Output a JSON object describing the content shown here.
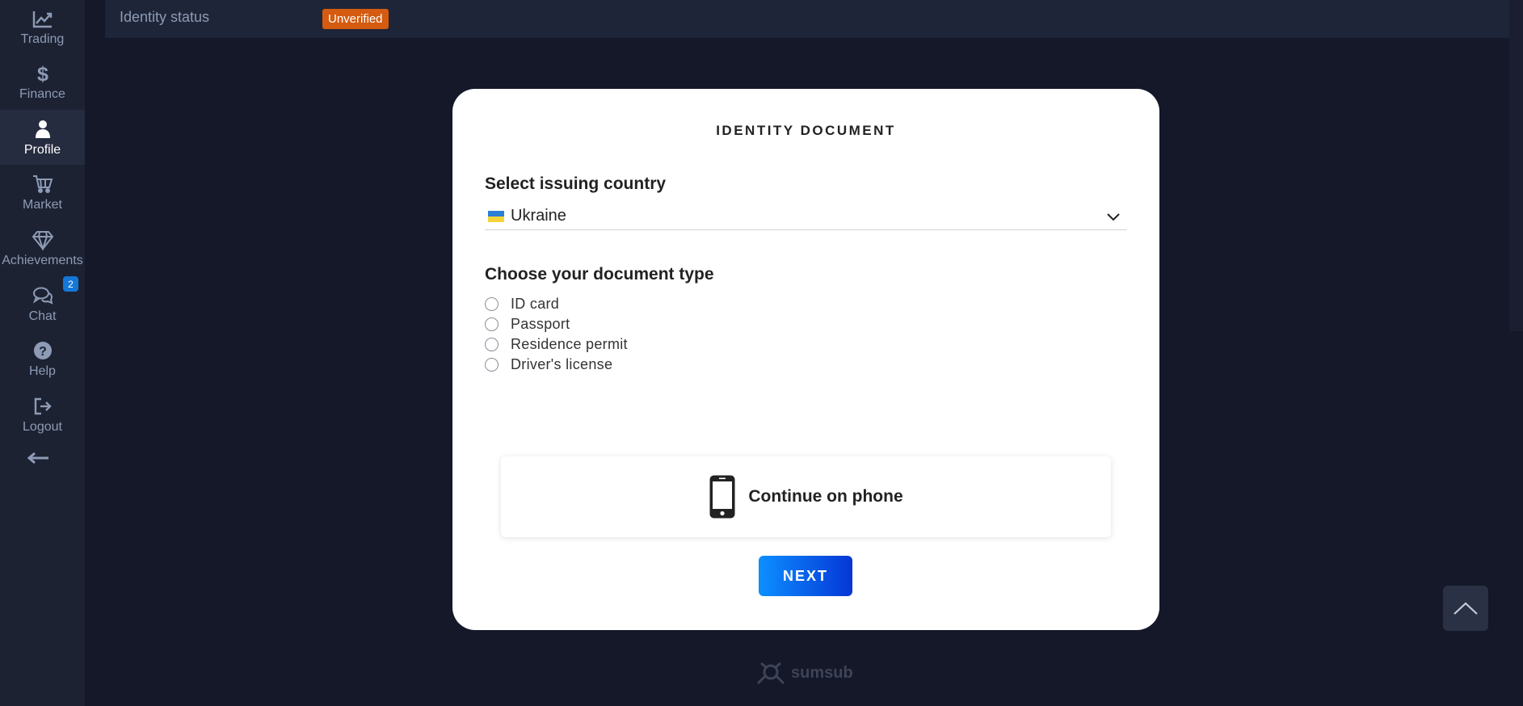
{
  "sidebar": {
    "items": [
      {
        "label": "Trading",
        "icon": "chart-line-icon"
      },
      {
        "label": "Finance",
        "icon": "dollar-icon"
      },
      {
        "label": "Profile",
        "icon": "user-icon"
      },
      {
        "label": "Market",
        "icon": "cart-icon"
      },
      {
        "label": "Achievements",
        "icon": "diamond-icon"
      },
      {
        "label": "Chat",
        "icon": "chat-bubbles-icon"
      },
      {
        "label": "Help",
        "icon": "question-circle-icon"
      },
      {
        "label": "Logout",
        "icon": "logout-icon"
      }
    ],
    "active": "Profile",
    "chat_badge": "2"
  },
  "topbar": {
    "label": "Identity status",
    "status": "Unverified",
    "status_color": "#d45b0f"
  },
  "modal": {
    "title": "IDENTITY DOCUMENT",
    "country_heading": "Select issuing country",
    "country_value": "Ukraine",
    "doc_heading": "Choose your document type",
    "doc_types": [
      "ID card",
      "Passport",
      "Residence permit",
      "Driver's license"
    ],
    "phone_label": "Continue on phone",
    "next_label": "NEXT"
  },
  "footer": {
    "brand": "sumsub"
  },
  "colors": {
    "accent": "#0d8fff",
    "background": "#141829",
    "sidebar": "#1d2233"
  }
}
